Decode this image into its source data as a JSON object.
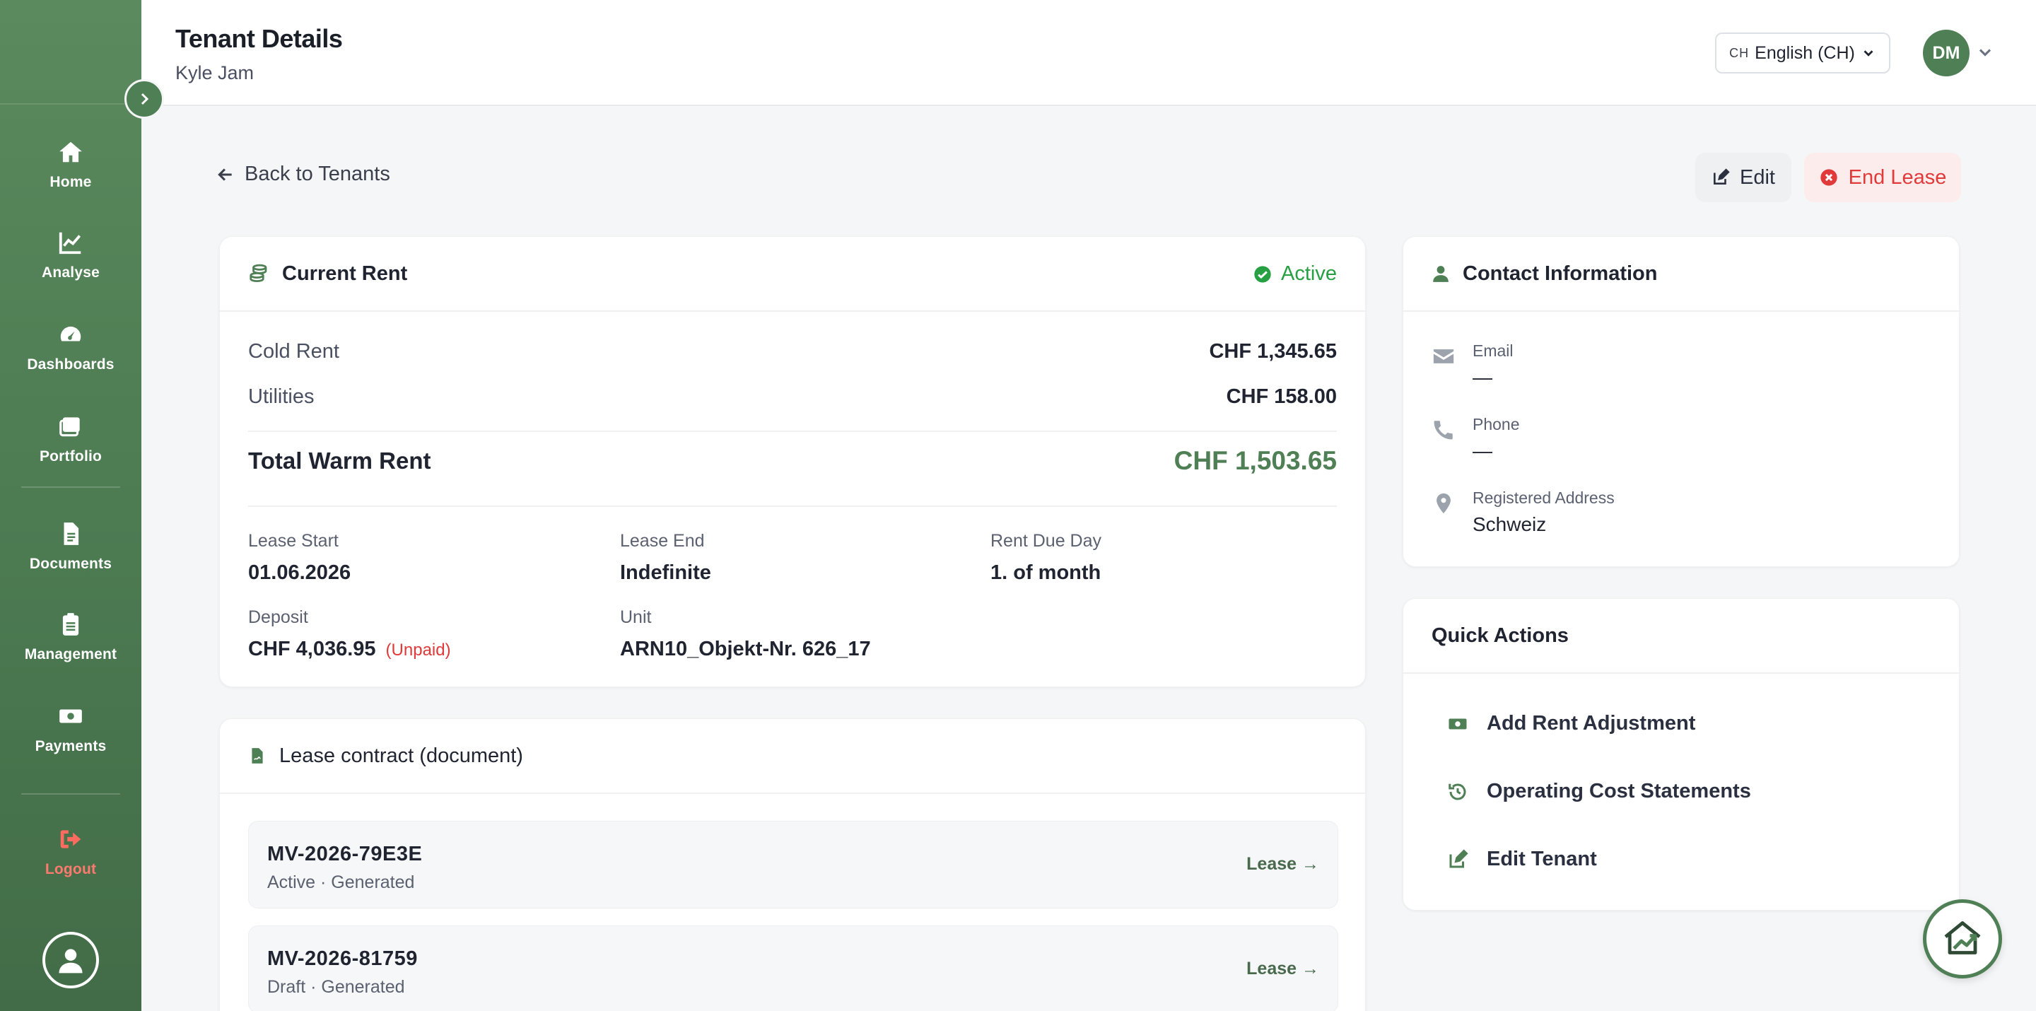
{
  "sidebar": {
    "items": [
      {
        "label": "Home",
        "icon": "home-icon"
      },
      {
        "label": "Analyse",
        "icon": "chart-line-icon"
      },
      {
        "label": "Dashboards",
        "icon": "gauge-icon"
      },
      {
        "label": "Portfolio",
        "icon": "portfolio-icon"
      },
      {
        "label": "Documents",
        "icon": "document-icon"
      },
      {
        "label": "Management",
        "icon": "clipboard-icon"
      },
      {
        "label": "Payments",
        "icon": "money-icon"
      }
    ],
    "logout_label": "Logout"
  },
  "header": {
    "title": "Tenant Details",
    "subtitle": "Kyle Jam",
    "language_code": "CH",
    "language_label": "English (CH)",
    "avatar_initials": "DM"
  },
  "actions": {
    "back_label": "Back to Tenants",
    "edit_label": "Edit",
    "end_lease_label": "End Lease"
  },
  "rent": {
    "title": "Current Rent",
    "status": "Active",
    "cold_rent_label": "Cold Rent",
    "cold_rent_value": "CHF 1,345.65",
    "utilities_label": "Utilities",
    "utilities_value": "CHF 158.00",
    "total_label": "Total Warm Rent",
    "total_value": "CHF 1,503.65",
    "lease_start_label": "Lease Start",
    "lease_start_value": "01.06.2026",
    "lease_end_label": "Lease End",
    "lease_end_value": "Indefinite",
    "due_day_label": "Rent Due Day",
    "due_day_value": "1. of month",
    "deposit_label": "Deposit",
    "deposit_value": "CHF 4,036.95",
    "deposit_status": "(Unpaid)",
    "unit_label": "Unit",
    "unit_value": "ARN10_Objekt-Nr. 626_17"
  },
  "documents": {
    "title": "Lease contract (document)",
    "items": [
      {
        "name": "MV-2026-79E3E",
        "meta": "Active · Generated",
        "link": "Lease →"
      },
      {
        "name": "MV-2026-81759",
        "meta": "Draft · Generated",
        "link": "Lease →"
      }
    ]
  },
  "contact": {
    "title": "Contact Information",
    "email_label": "Email",
    "email_value": "—",
    "phone_label": "Phone",
    "phone_value": "—",
    "address_label": "Registered Address",
    "address_value": "Schweiz"
  },
  "quick_actions": {
    "title": "Quick Actions",
    "items": [
      {
        "label": "Add Rent Adjustment",
        "icon": "money-icon"
      },
      {
        "label": "Operating Cost Statements",
        "icon": "history-icon"
      },
      {
        "label": "Edit Tenant",
        "icon": "edit-icon"
      }
    ]
  },
  "colors": {
    "brand_green": "#4f7f54",
    "active_green": "#27a043",
    "danger_red": "#e03a3a"
  }
}
